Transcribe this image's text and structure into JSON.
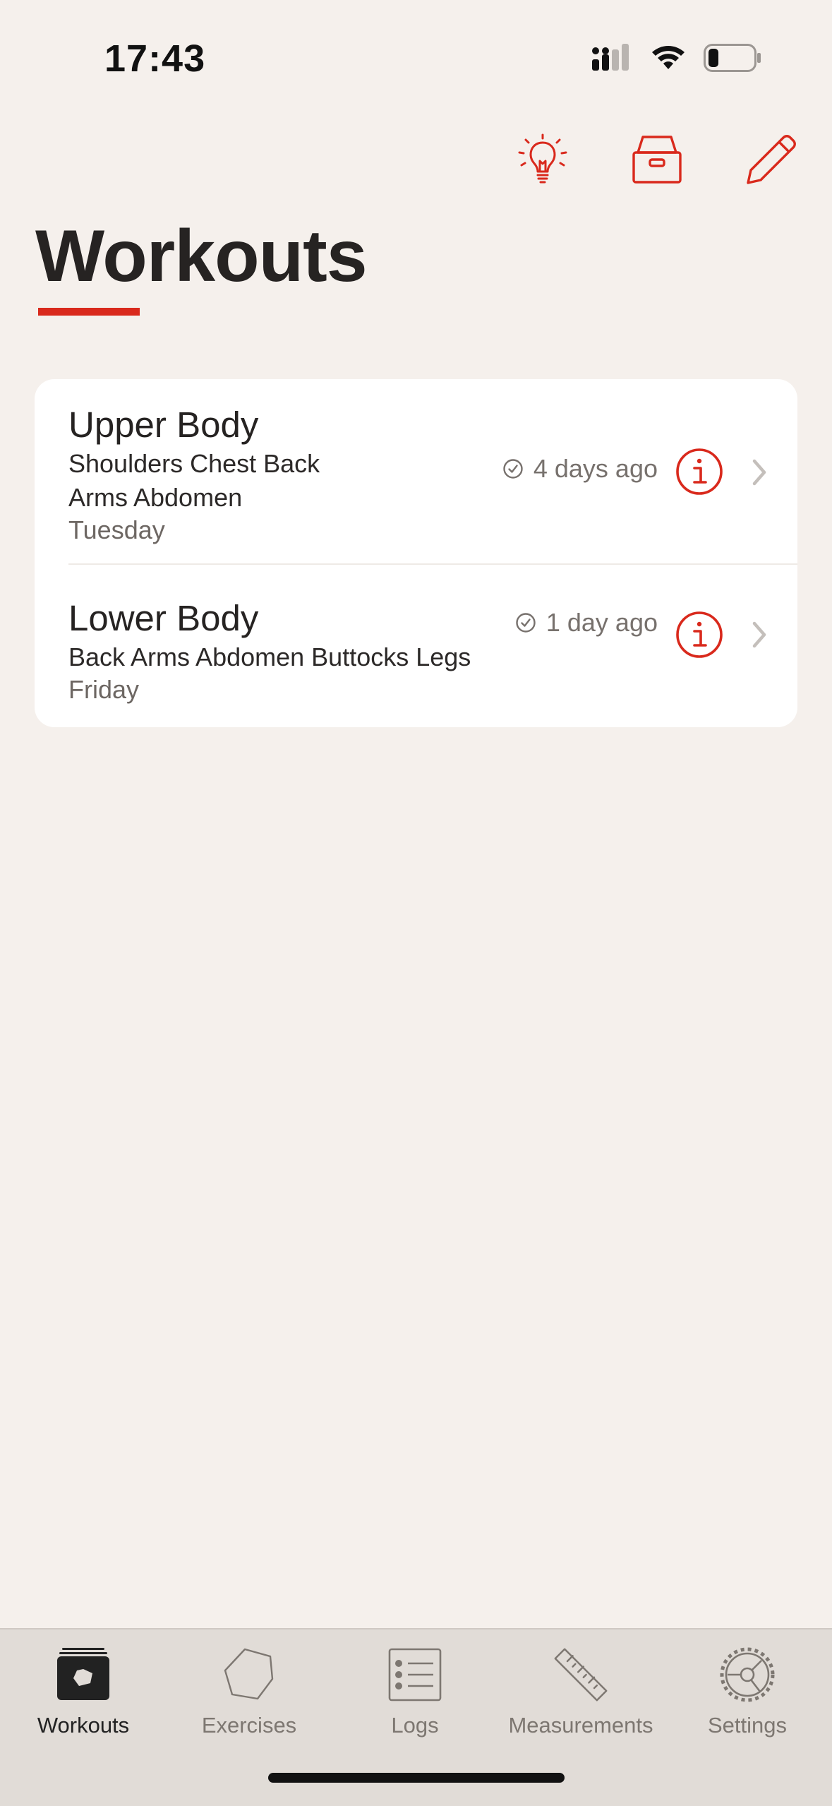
{
  "status_bar": {
    "time": "17:43",
    "icons": [
      "cellular-signal-icon",
      "wifi-icon",
      "battery-icon"
    ]
  },
  "toolbar": {
    "buttons": [
      "lightbulb-icon",
      "archive-icon",
      "pencil-icon"
    ]
  },
  "page": {
    "title": "Workouts"
  },
  "workouts": [
    {
      "title": "Upper Body",
      "muscles_line1": "Shoulders Chest Back",
      "muscles_line2": "Arms Abdomen",
      "day": "Tuesday",
      "last_done": "4 days ago"
    },
    {
      "title": "Lower Body",
      "muscles_line1": "Back Arms Abdomen Buttocks Legs",
      "day": "Friday",
      "last_done": "1 day ago"
    }
  ],
  "tabs": [
    {
      "label": "Workouts",
      "icon": "workouts-icon",
      "active": true
    },
    {
      "label": "Exercises",
      "icon": "hexagon-icon",
      "active": false
    },
    {
      "label": "Logs",
      "icon": "list-icon",
      "active": false
    },
    {
      "label": "Measurements",
      "icon": "ruler-icon",
      "active": false
    },
    {
      "label": "Settings",
      "icon": "gear-icon",
      "active": false
    }
  ],
  "colors": {
    "accent": "#d9291c",
    "background": "#f5f0ec",
    "card": "#ffffff",
    "tab_bar": "#e1dcd7"
  }
}
